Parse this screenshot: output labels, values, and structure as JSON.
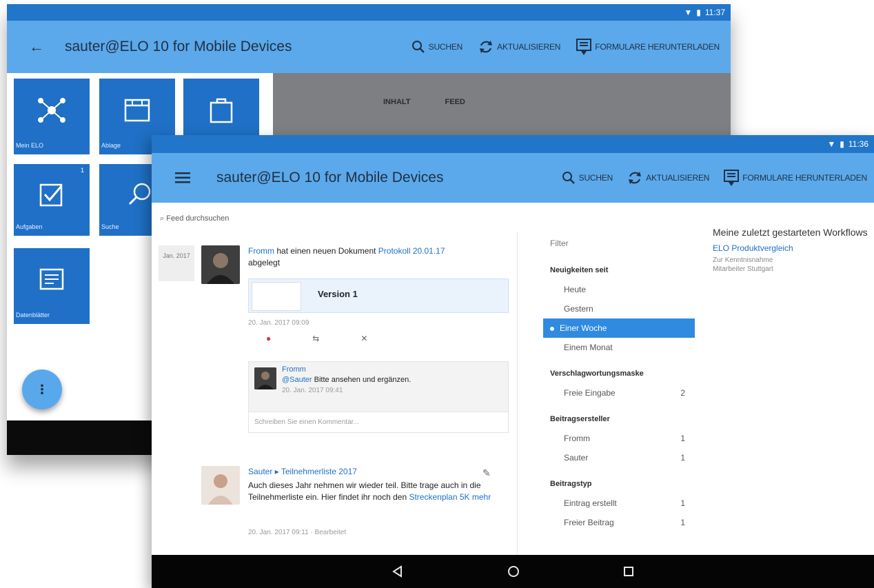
{
  "back_screen": {
    "status_time": "11:37",
    "title": "sauter@ELO 10 for Mobile Devices",
    "actions": {
      "search": "SUCHEN",
      "refresh": "AKTUALISIEREN",
      "download": "FORMULARE HERUNTERLADEN"
    },
    "tiles": [
      {
        "label": "Mein ELO",
        "icon": "network-icon"
      },
      {
        "label": "Ablage",
        "icon": "archive-icon"
      },
      {
        "label": "",
        "icon": "bag-icon"
      },
      {
        "label": "Aufgaben",
        "icon": "checkbox-icon",
        "badge": "1"
      },
      {
        "label": "Suche",
        "icon": "search-icon"
      },
      {
        "label": "Datenblätter",
        "icon": "form-icon"
      }
    ],
    "tabs": [
      "INHALT",
      "FEED"
    ],
    "fab": "⋮"
  },
  "front_screen": {
    "status_time": "11:36",
    "title": "sauter@ELO 10 for Mobile Devices",
    "actions": {
      "search": "SUCHEN",
      "refresh": "AKTUALISIEREN",
      "download": "FORMULARE HERUNTERLADEN"
    },
    "filter_line": "Feed durchsuchen",
    "posts": [
      {
        "date": "Jan. 2017",
        "author": "Fromm",
        "text_pre": "hat einen neuen Dokument",
        "doc_link": "Protokoll 20.01.17",
        "text_post": "abgelegt",
        "doc_version": "Version 1",
        "timestamp": "20. Jan. 2017 09:09",
        "comment": {
          "author": "Fromm",
          "mention": "@Sauter",
          "text": "Bitte ansehen und ergänzen.",
          "timestamp": "20. Jan. 2017 09:41"
        },
        "comment_placeholder": "Schreiben Sie einen Kommentar..."
      },
      {
        "author": "Sauter",
        "link_title": "Teilnehmerliste 2017",
        "text": "Auch dieses Jahr nehmen wir wieder teil. Bitte trage auch in die Teilnehmerliste ein. Hier findet ihr noch den",
        "link2": "Streckenplan 5K mehr",
        "timestamp": "20. Jan. 2017 09:11 · Bearbeitet"
      }
    ],
    "filter_panel": {
      "title": "Filter",
      "sections": [
        {
          "heading": "Neuigkeiten seit",
          "items": [
            {
              "label": "Heute",
              "count": ""
            },
            {
              "label": "Gestern",
              "count": ""
            },
            {
              "label": "Einer Woche",
              "count": "",
              "active": true
            },
            {
              "label": "Einem Monat",
              "count": ""
            }
          ]
        },
        {
          "heading": "Verschlagwortungsmaske",
          "items": [
            {
              "label": "Freie Eingabe",
              "count": "2"
            }
          ]
        },
        {
          "heading": "Beitragsersteller",
          "items": [
            {
              "label": "Fromm",
              "count": "1"
            },
            {
              "label": "Sauter",
              "count": "1"
            }
          ]
        },
        {
          "heading": "Beitragstyp",
          "items": [
            {
              "label": "Eintrag erstellt",
              "count": "1"
            },
            {
              "label": "Freier Beitrag",
              "count": "1"
            }
          ]
        }
      ]
    },
    "workflows": {
      "title": "Meine zuletzt gestarteten Workflows",
      "link": "ELO Produktvergleich",
      "sub1": "Zur Kenntnisnahme",
      "sub2": "Mitarbeiter Stuttgart"
    }
  }
}
